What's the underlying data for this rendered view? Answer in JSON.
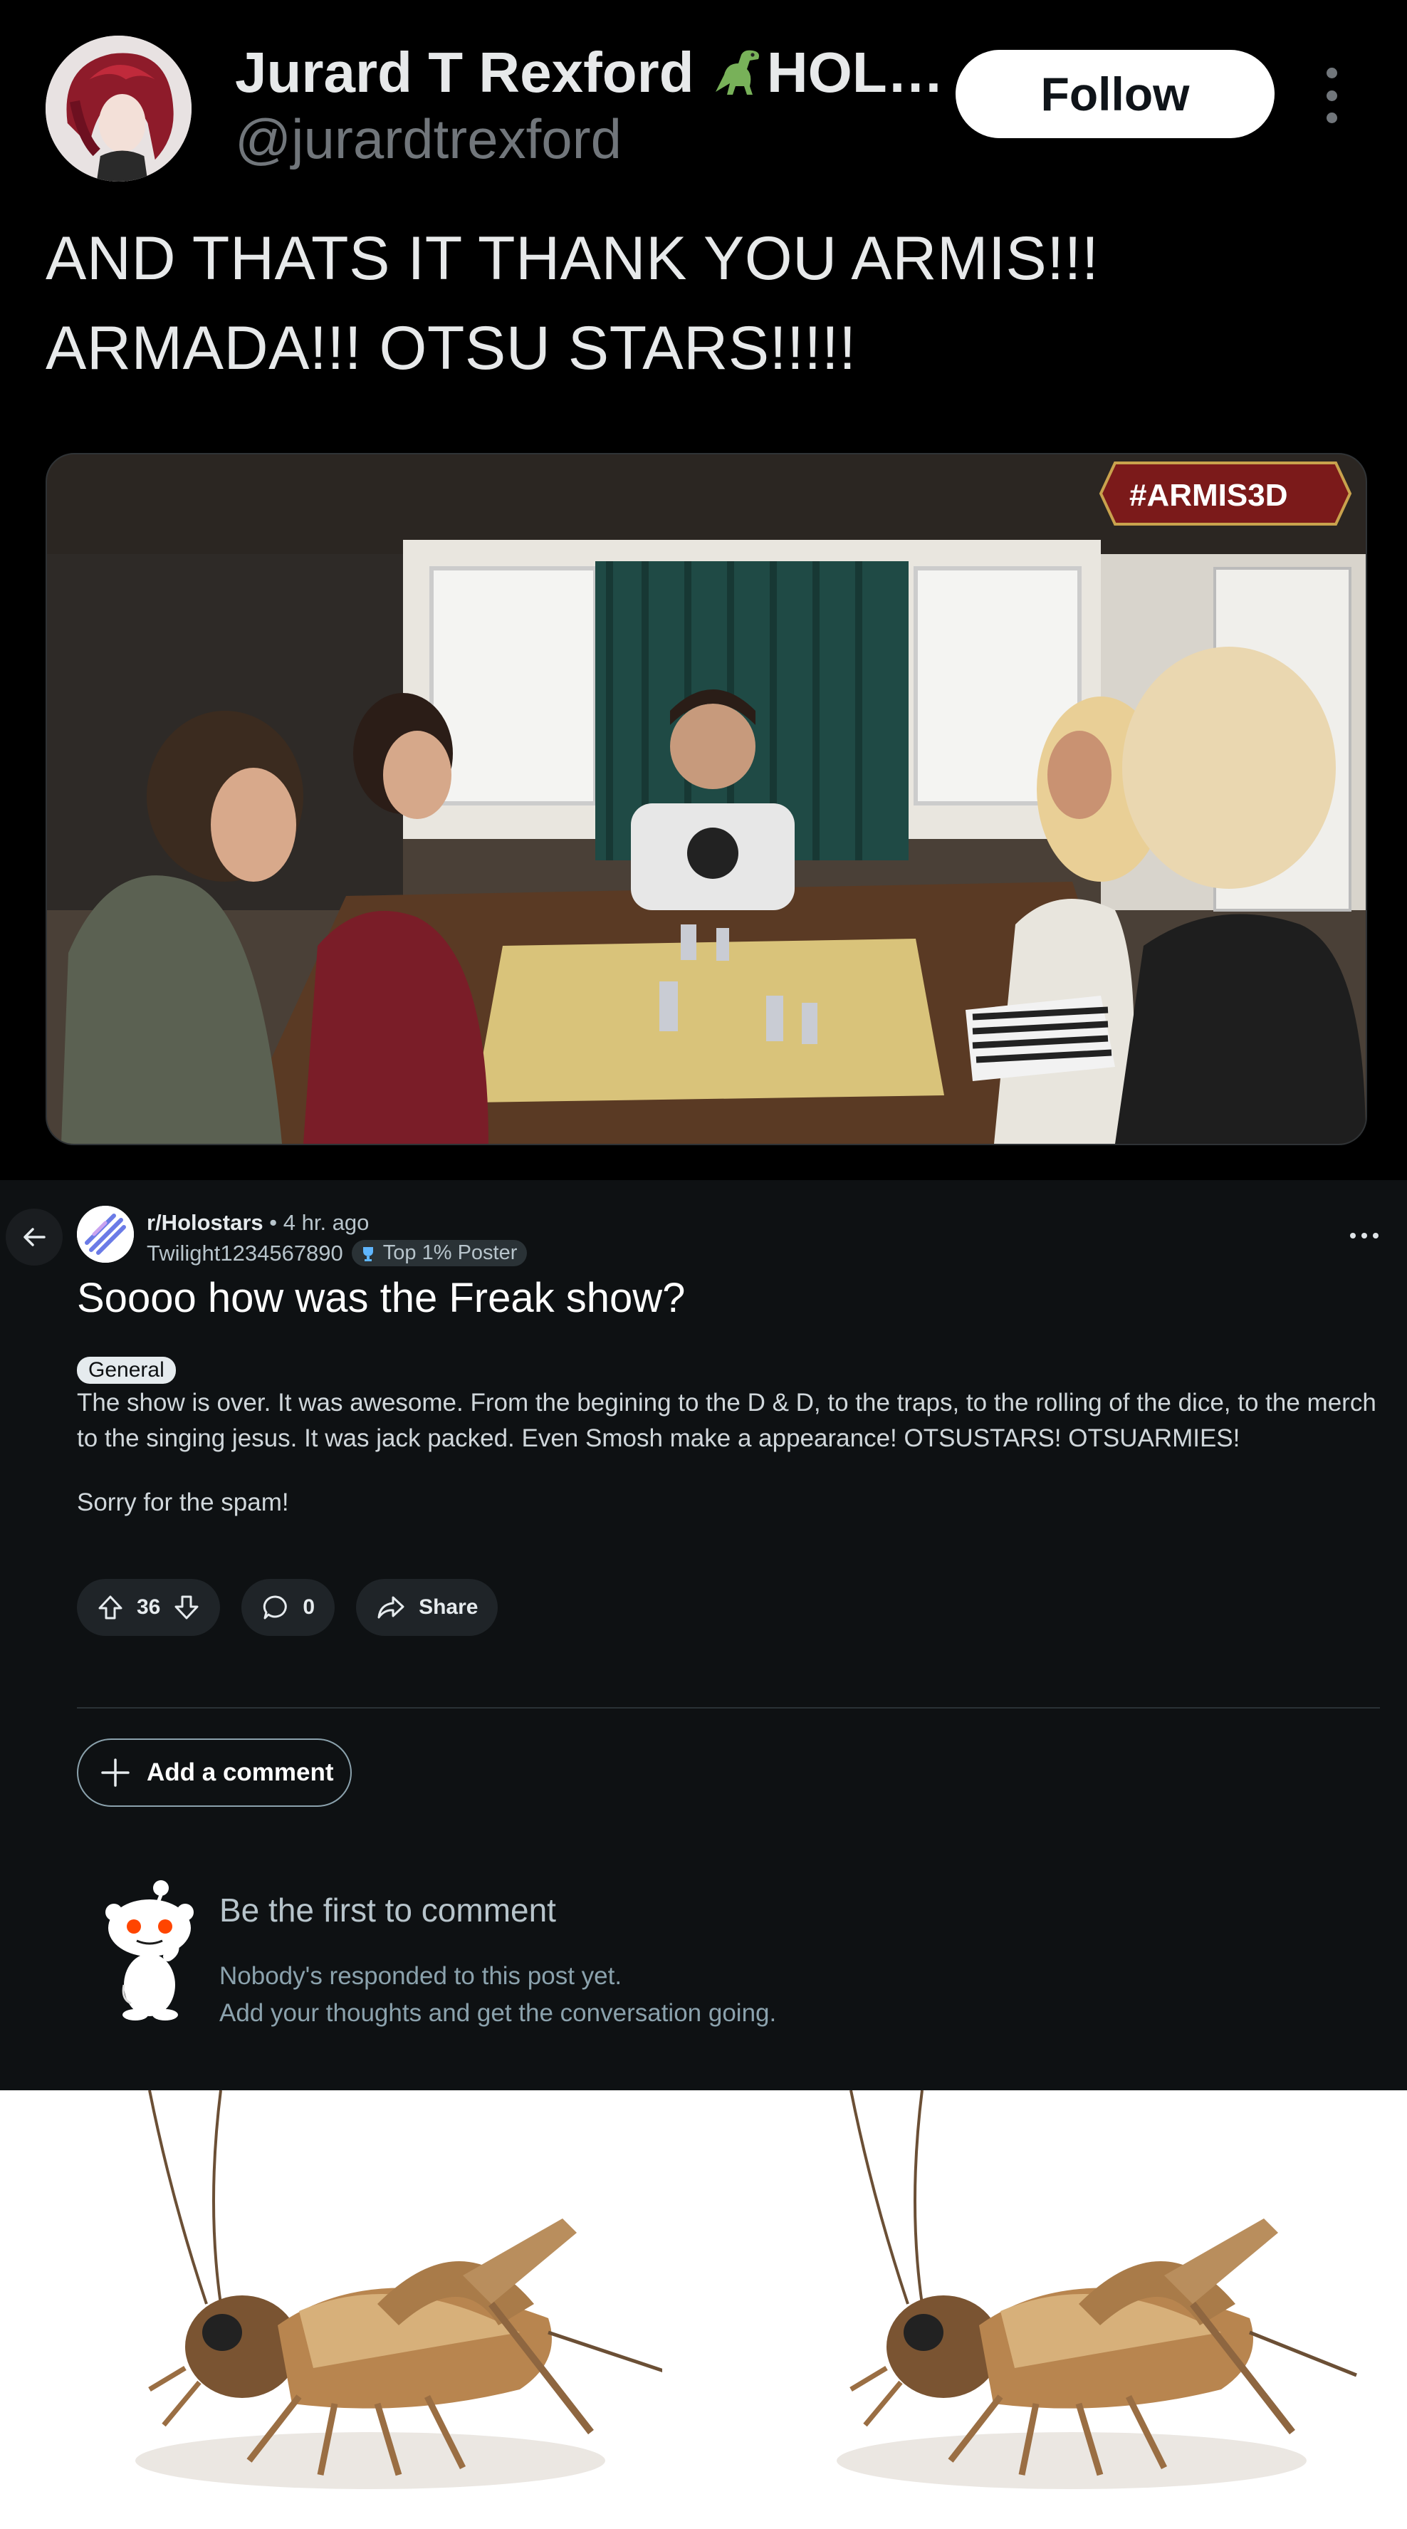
{
  "tweet": {
    "display_name": "Jurard T Rexford",
    "display_name_suffix": "HOL…",
    "handle": "@jurardtrexford",
    "follow_label": "Follow",
    "text_line1": "AND THATS IT THANK YOU ARMIS!!!",
    "text_line2": "ARMADA!!! OTSU STARS!!!!!",
    "media_tag": "#ARMIS3D",
    "icons": [
      "dinosaur-emoji-icon",
      "more-vertical-icon"
    ]
  },
  "reddit": {
    "subreddit": "r/Holostars",
    "time": " • 4 hr. ago",
    "username": "Twilight1234567890",
    "user_flair": "Top 1% Poster",
    "title": "Soooo how was the Freak show?",
    "post_flair": "General",
    "body_p1": "The show is over. It was awesome. From the begining to the D & D, to the traps, to the rolling of the dice, to the merch to the singing jesus. It was jack packed. Even Smosh make a appearance! OTSUSTARS! OTSUARMIES!",
    "body_p2": "Sorry for the spam!",
    "upvotes": "36",
    "comments": "0",
    "share_label": "Share",
    "add_comment_label": "Add a comment",
    "empty_title": "Be the first to comment",
    "empty_line1": "Nobody's responded to this post yet.",
    "empty_line2": "Add your thoughts and get the conversation going.",
    "colors": {
      "background": "#0e1113",
      "pill": "#1f2428",
      "text_muted": "#8ba2ad"
    },
    "icons": [
      "back-arrow-icon",
      "more-horizontal-icon",
      "upvote-icon",
      "downvote-icon",
      "comment-icon",
      "share-icon",
      "plus-icon",
      "snoo-mascot-icon"
    ]
  },
  "bottom_image": {
    "subject": "two crickets"
  }
}
